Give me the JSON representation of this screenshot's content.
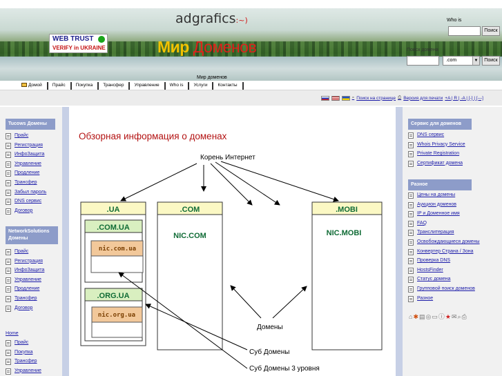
{
  "header": {
    "logo": "adgrafics",
    "logo_smile": ":~)",
    "webtrust_line1": "WEB TRUST",
    "webtrust_line2": "VERIFY in UKRAINE",
    "title_part1": "Мир",
    "title_part2": "Доменов",
    "subtitle": "Мир доменов",
    "whois_label": "Who is",
    "whois_button": "Поиск",
    "domain_search_label": "Поиск домена",
    "zone_select": ".com",
    "domain_button": "Поиск"
  },
  "nav": [
    "Домой",
    "Прайс",
    "Покупка",
    "Трансфер",
    "Управление",
    "Who is",
    "Услуги",
    "Контакты"
  ],
  "toolbar": {
    "search_link": "Поиск на странице",
    "print_link": "Версия для печати",
    "font_controls": "+A | R | -A | [-] | [---]"
  },
  "left": {
    "tucows_title": "Tucows Домены",
    "tucows_items": [
      "Прайс",
      "Регистрация",
      "ИнфоЗащита",
      "Управление",
      "Продление",
      "Трансфер",
      "Забыл пароль",
      "DNS сервис",
      "Договор"
    ],
    "ns_title": "NetworkSolutions Домены",
    "ns_items": [
      "Прайс",
      "Регистрация",
      "ИнфоЗащита",
      "Управление",
      "Продление",
      "Трансфер",
      "Договор"
    ],
    "home_link": "Home",
    "home_items": [
      "Прайс",
      "Покупка",
      "Трансфер",
      "Управление"
    ]
  },
  "right": {
    "service_title": "Сервис для доменов",
    "service_items": [
      "DNS сервис",
      "Whois Privacy Service",
      "Private Registration",
      "Сертификат домена"
    ],
    "misc_title": "Разное",
    "misc_items": [
      "Цены на домены",
      "Аукцион доменов",
      "IP и Доменное имя",
      "FAQ",
      "Транслитерация",
      "Освобождающиеся домены",
      "Конвертер Страна / Зона",
      "Проверка DNS",
      "HostsFinder",
      "Статус домена",
      "Групповой поиск доменов",
      "Разное"
    ]
  },
  "main": {
    "title": "Обзорная информация о доменах",
    "root_label": "Корень Интернет",
    "zone_ua": ".UA",
    "zone_com": ".COM",
    "zone_mobi": ".MOBI",
    "sub_comua": ".COM.UA",
    "sub_orgua": ".ORG.UA",
    "nic_comua": "nic.com.ua",
    "nic_orgua": "nic.org.ua",
    "nic_com": "NIC.COM",
    "nic_mobi": "NIC.MOBI",
    "label_domains": "Домены",
    "label_sub": "Суб Домены",
    "label_sub3": "Суб Домены 3 уровня"
  },
  "colors": {
    "zone_header": "#fbf8c4",
    "sub_header": "#d9efc0",
    "nic_box": "#f2c89a",
    "zone_text": "#0f6b35",
    "nic_text": "#7a3e00",
    "title_red": "#b31212",
    "menu_header": "#8d9cc9"
  }
}
